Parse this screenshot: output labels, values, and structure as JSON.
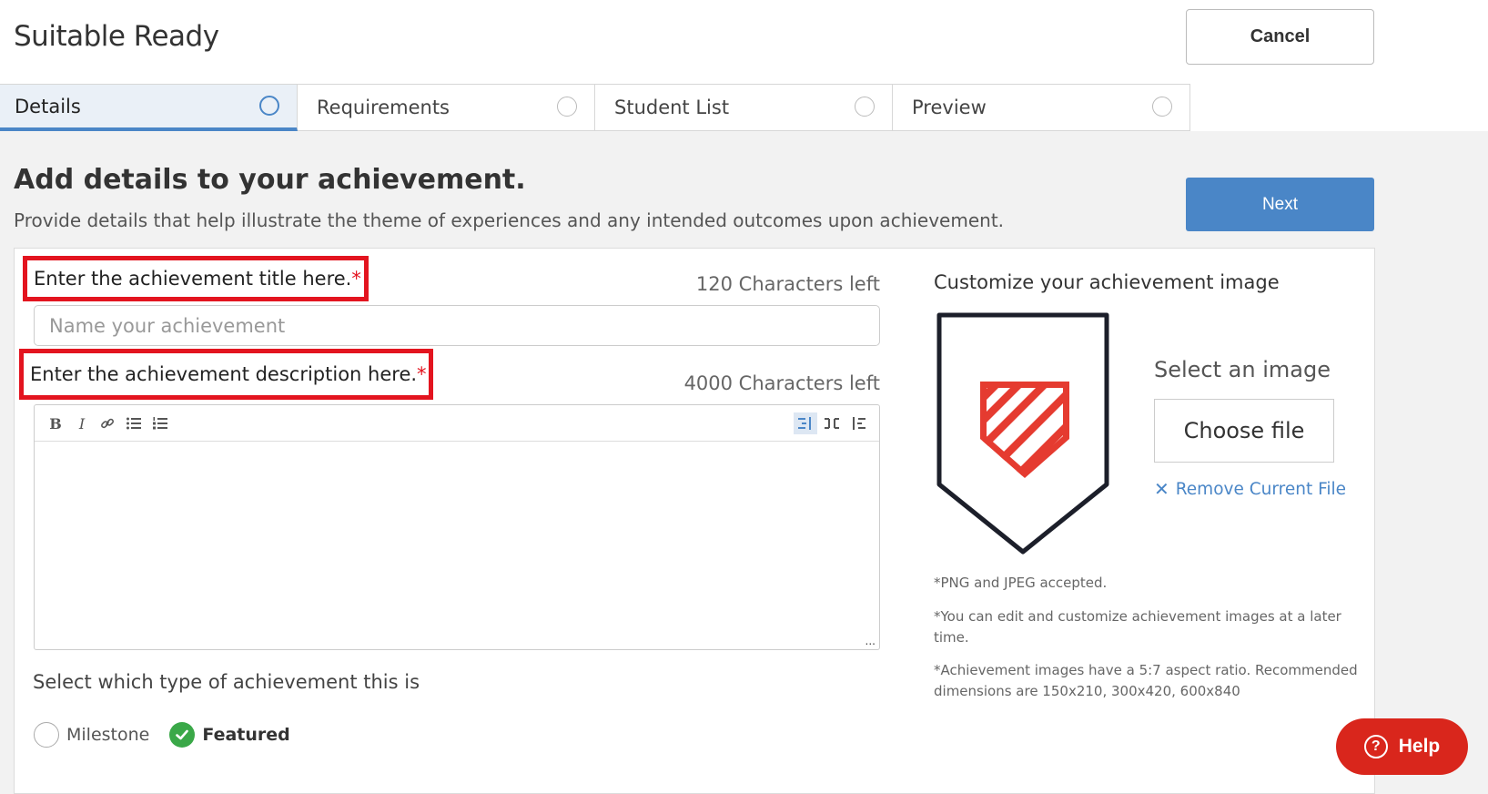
{
  "header": {
    "app_title": "Suitable Ready",
    "cancel_label": "Cancel"
  },
  "tabs": [
    {
      "label": "Details",
      "active": true
    },
    {
      "label": "Requirements",
      "active": false
    },
    {
      "label": "Student List",
      "active": false
    },
    {
      "label": "Preview",
      "active": false
    }
  ],
  "main": {
    "heading": "Add details to your achievement.",
    "subheading": "Provide details that help illustrate the theme of experiences and any intended outcomes upon achievement.",
    "next_label": "Next"
  },
  "form": {
    "title_label": "Enter the achievement title here.",
    "required_mark": "*",
    "title_chars_left": "120 Characters left",
    "title_placeholder": "Name your achievement",
    "title_value": "",
    "description_label": "Enter the achievement description here.",
    "description_chars_left": "4000 Characters left",
    "description_value": "",
    "toolbar": [
      "bold-icon",
      "italic-icon",
      "link-icon",
      "bullet-list-icon",
      "numbered-list-icon",
      "align-left-icon",
      "align-center-icon",
      "align-right-icon"
    ],
    "editor_more": "...",
    "type_label": "Select which type of achievement this is",
    "type_options": [
      {
        "label": "Milestone",
        "selected": false
      },
      {
        "label": "Featured",
        "selected": true
      }
    ]
  },
  "image_panel": {
    "title": "Customize your achievement image",
    "select_label": "Select an image",
    "choose_file_label": "Choose file",
    "remove_label": "Remove Current File",
    "notes": [
      "*PNG and JPEG accepted.",
      "*You can edit and customize achievement images at a later time.",
      "*Achievement images have a 5:7 aspect ratio. Recommended dimensions are 150x210, 300x420, 600x840"
    ]
  },
  "help": {
    "label": "Help"
  },
  "colors": {
    "accent": "#4a86c7",
    "required": "#e3141f",
    "success": "#3aa848",
    "help": "#d9261c"
  }
}
